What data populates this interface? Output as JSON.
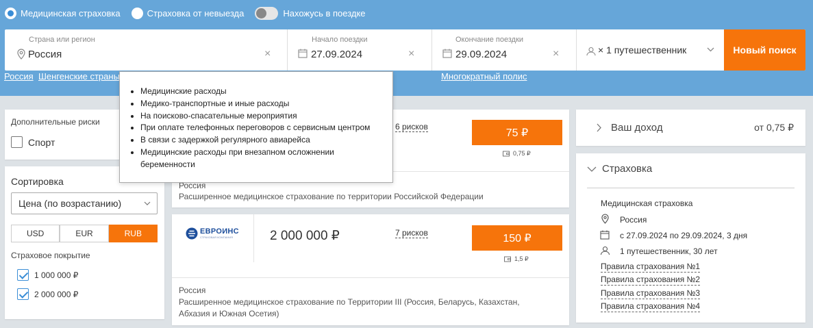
{
  "top": {
    "radio_medical": "Медицинская страховка",
    "radio_noexit": "Страховка от невыезда",
    "toggle_label": "Нахожусь в поездке"
  },
  "search": {
    "country_label": "Страна или регион",
    "country_value": "Россия",
    "start_label": "Начало поездки",
    "start_value": "27.09.2024",
    "end_label": "Окончание поездки",
    "end_value": "29.09.2024",
    "travelers": "× 1 путешественник",
    "new_search": "Новый поиск",
    "clear": "×"
  },
  "quick_links": {
    "russia": "Россия",
    "schengen": "Шенгенские страны",
    "multi": "Многократный полис"
  },
  "filters": {
    "extra_risks_title": "Дополнительные риски",
    "sport": "Спорт",
    "sort_title": "Сортировка",
    "sort_value": "Цена (по возрастанию)",
    "currencies": [
      "USD",
      "EUR",
      "RUB"
    ],
    "coverage_title": "Страховое покрытие",
    "coverage_1": "1 000 000 ₽",
    "coverage_2": "2 000 000 ₽"
  },
  "tooltip": {
    "items": [
      "Медицинские расходы",
      "Медико-транспортные и иные расходы",
      "На поисково-спасательные мероприятия",
      "При оплате телефонных переговоров с сервисным центром",
      "В связи с задержкой регулярного авиарейса",
      "Медицинские расходы при внезапном осложнении беременности"
    ]
  },
  "offers": [
    {
      "risks": "6 рисков",
      "price": "75 ₽",
      "cashback": "0,75 ₽",
      "region": "Россия",
      "description": "Расширенное медицинское страхование по территории Российской Федерации"
    },
    {
      "company": "ЕВРОИНС",
      "company_sub": "СТРАХОВАЯ КОМПАНИЯ",
      "coverage": "2 000 000 ₽",
      "risks": "7 рисков",
      "price": "150 ₽",
      "cashback": "1,5 ₽",
      "region": "Россия",
      "description": "Расширенное медицинское страхование по Территории III (Россия, Беларусь, Казахстан, Абхазия и Южная Осетия)"
    }
  ],
  "income": {
    "label": "Ваш доход",
    "value": "от 0,75 ₽"
  },
  "summary": {
    "title": "Страховка",
    "type": "Медицинская страховка",
    "country": "Россия",
    "dates": "с 27.09.2024 по 29.09.2024, 3 дня",
    "travelers": "1 путешественник, 30 лет",
    "rules": [
      "Правила страхования №1",
      "Правила страхования №2",
      "Правила страхования №3",
      "Правила страхования №4"
    ]
  },
  "colors": {
    "header_bg": "#66a6d9",
    "accent": "#f6740b",
    "check_blue": "#3a8dd6",
    "page_bg": "#dde2e6"
  }
}
